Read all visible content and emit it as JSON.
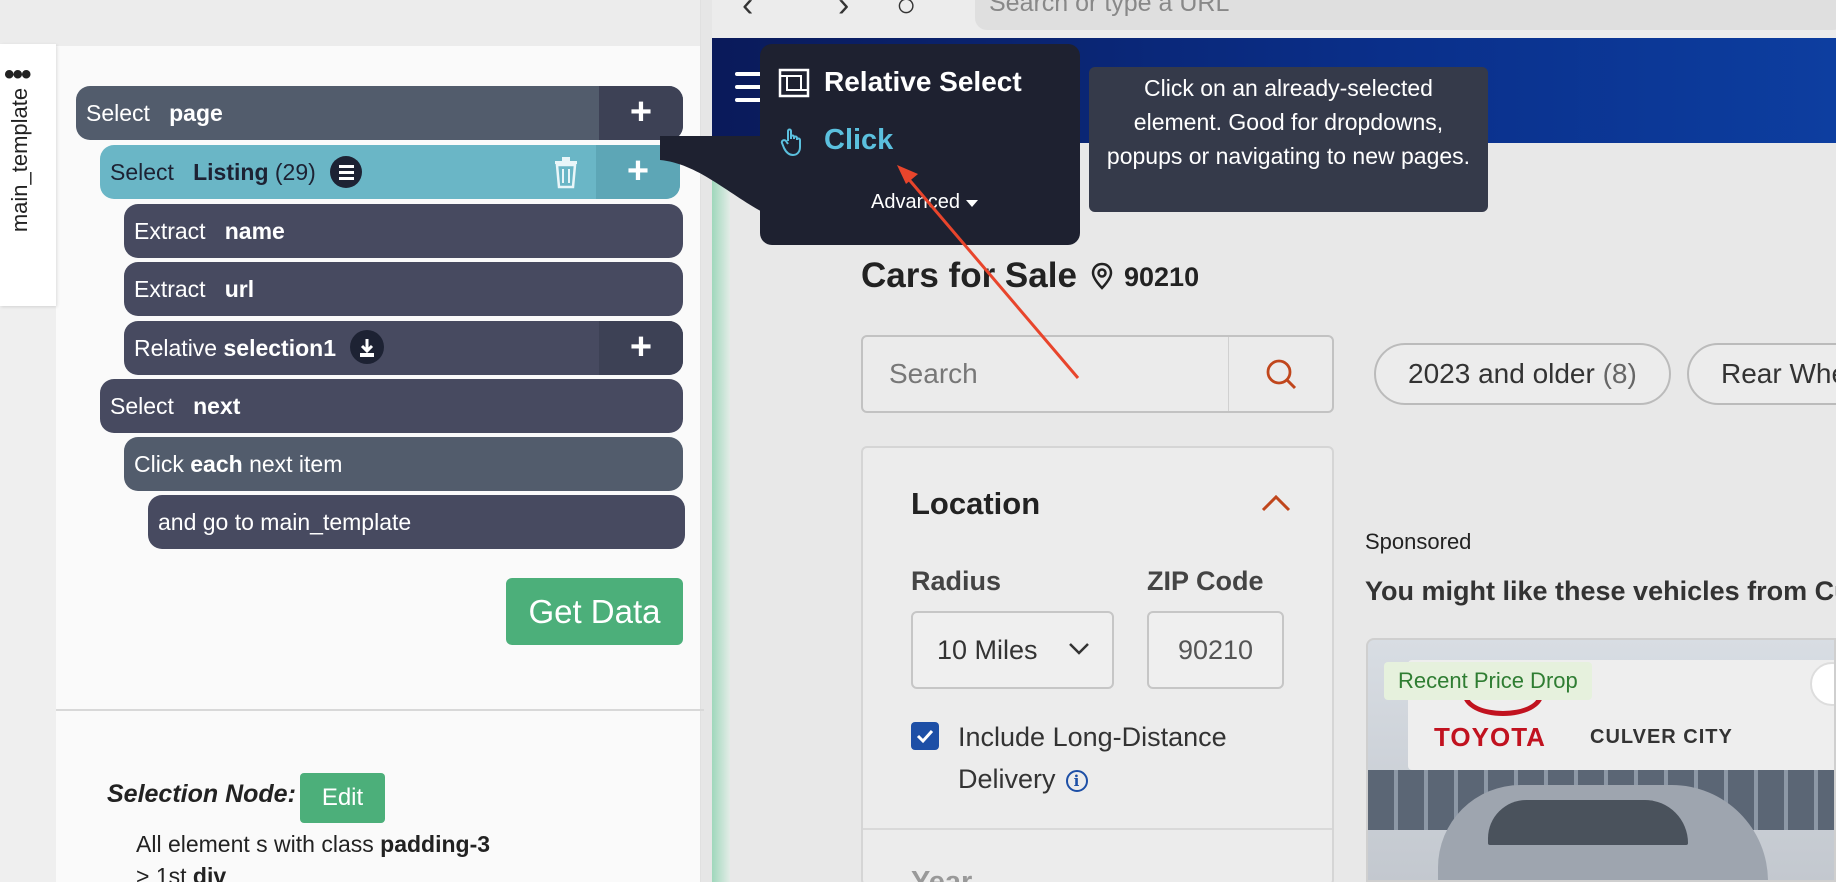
{
  "sidebar": {
    "vertical_tab_label": "main_template",
    "commands": [
      {
        "prefix": "Select",
        "name": "page"
      },
      {
        "prefix": "Select",
        "name": "Listing",
        "count": "(29)"
      },
      {
        "prefix": "Extract",
        "name": "name"
      },
      {
        "prefix": "Extract",
        "name": "url"
      },
      {
        "prefix": "Relative",
        "name": "selection1"
      },
      {
        "prefix": "Select",
        "name": "next"
      },
      {
        "prefix": "Click",
        "name": "each",
        "suffix": "next item"
      },
      {
        "prefix": "and go to main_template"
      }
    ],
    "plus_symbol": "+",
    "get_data_label": "Get Data",
    "selection_node": {
      "label": "Selection Node:",
      "edit_label": "Edit",
      "line1_prefix": "All element s with class",
      "line1_class": "padding-3",
      "line2_prefix": "> 1st",
      "line2_tag": "div"
    }
  },
  "popover": {
    "title": "Relative Select",
    "action": "Click",
    "advanced": "Advanced",
    "tooltip": "Click on an already-selected element. Good for dropdowns, popups or navigating to new pages."
  },
  "browser": {
    "url_placeholder": "Search or type a URL"
  },
  "site": {
    "title": "Cars for Sale",
    "zip": "90210",
    "search_placeholder": "Search",
    "chips": [
      {
        "label": "2023 and older",
        "count": "(8)"
      },
      {
        "label": "Rear Whe"
      }
    ],
    "location": {
      "title": "Location",
      "radius_label": "Radius",
      "zip_label": "ZIP Code",
      "radius_value": "10 Miles",
      "zip_value": "90210",
      "checkbox_label": "Include Long-Distance Delivery",
      "checkbox_checked": true,
      "next_section": "Year"
    },
    "sponsored": "Sponsored",
    "might_like": "You might like these vehicles from Cu",
    "listing": {
      "badge": "Recent Price Drop",
      "dealer_brand": "TOYOTA",
      "dealer_city": "CULVER CITY"
    }
  },
  "colors": {
    "accent_green": "#4caf7a",
    "teal_selected": "#6ab6c6",
    "command_dark": "#474a60",
    "popover_bg": "#1e2130",
    "click_blue": "#5bc0de",
    "annotation_arrow": "#e8452c",
    "site_header": "#0a2f8a"
  },
  "icons": {
    "menu": "more-dots-icon",
    "list": "list-icon",
    "trash": "trash-icon",
    "download": "download-icon",
    "search": "search-icon",
    "pin": "location-pin-icon",
    "chevron_up": "chevron-up-icon",
    "chevron_down": "chevron-down-icon",
    "info": "info-icon",
    "relative_select": "relative-select-icon",
    "hand_pointer": "hand-pointer-icon",
    "caret": "caret-down-icon"
  }
}
